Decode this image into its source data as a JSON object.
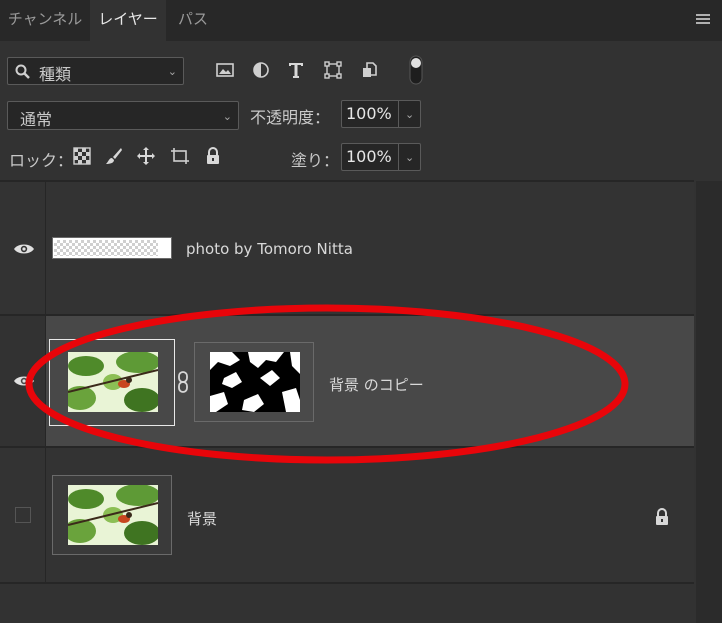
{
  "tabs": [
    {
      "label": "チャンネル",
      "active": false
    },
    {
      "label": "レイヤー",
      "active": true
    },
    {
      "label": "パス",
      "active": false
    }
  ],
  "filter": {
    "search_icon": "search-icon",
    "kind_label": "種類",
    "filter_icons": [
      "image-filter-icon",
      "adjustment-filter-icon",
      "type-filter-icon",
      "shape-filter-icon",
      "smart-object-filter-icon",
      "filter-toggle-icon"
    ]
  },
  "blend": {
    "mode": "通常",
    "opacity_label": "不透明度：",
    "opacity_value": "100%"
  },
  "lock": {
    "label": "ロック：",
    "icons": [
      "lock-transparent-pixels-icon",
      "lock-image-pixels-icon",
      "lock-position-icon",
      "lock-artboard-icon",
      "lock-all-icon"
    ],
    "fill_label": "塗り：",
    "fill_value": "100%"
  },
  "layers": [
    {
      "name": "photo by Tomoro Nitta",
      "visible": true,
      "kind": "text-raster"
    },
    {
      "name": "背景 のコピー",
      "visible": true,
      "selected": true,
      "has_mask": true
    },
    {
      "name": "背景",
      "visible": false,
      "locked": true
    }
  ],
  "annotation": {
    "color": "#e8050a"
  },
  "colors": {
    "panel": "#323232",
    "selected_row": "#484848",
    "tabbar": "#282828"
  }
}
